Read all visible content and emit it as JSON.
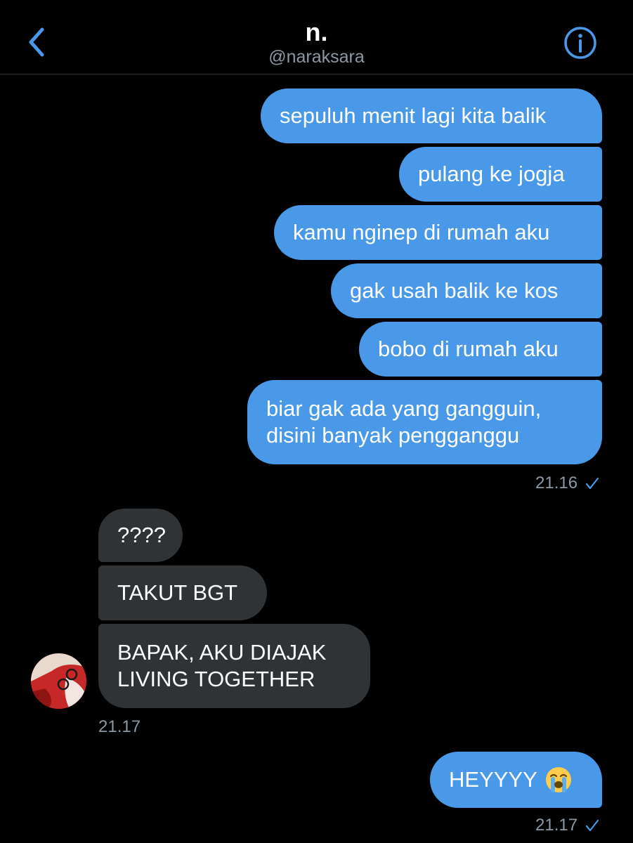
{
  "header": {
    "title": "n.",
    "handle": "@naraksara"
  },
  "messages_sent_1": [
    {
      "text": "sepuluh menit lagi kita balik"
    },
    {
      "text": "pulang ke jogja"
    },
    {
      "text": "kamu nginep di rumah aku"
    },
    {
      "text": "gak usah balik ke kos"
    },
    {
      "text": "bobo di rumah aku"
    },
    {
      "text": "biar gak ada yang gangguin, disini banyak pengganggu"
    }
  ],
  "time_sent_1": "21.16",
  "messages_received": [
    {
      "text": "????"
    },
    {
      "text": "TAKUT BGT"
    },
    {
      "text": "BAPAK, AKU DIAJAK LIVING TOGETHER"
    }
  ],
  "time_received": "21.17",
  "messages_sent_2": [
    {
      "text": "HEYYYY",
      "emoji": "loudly-crying-face"
    }
  ],
  "time_sent_2": "21.17",
  "colors": {
    "accent": "#4a99e9",
    "sent_bubble": "#4a99e9",
    "received_bubble": "#2f3336",
    "background": "#000000",
    "secondary_text": "#8b98a5"
  },
  "icons": {
    "back": "chevron-left-icon",
    "info": "info-circle-icon",
    "read_receipt": "checkmark-icon"
  }
}
